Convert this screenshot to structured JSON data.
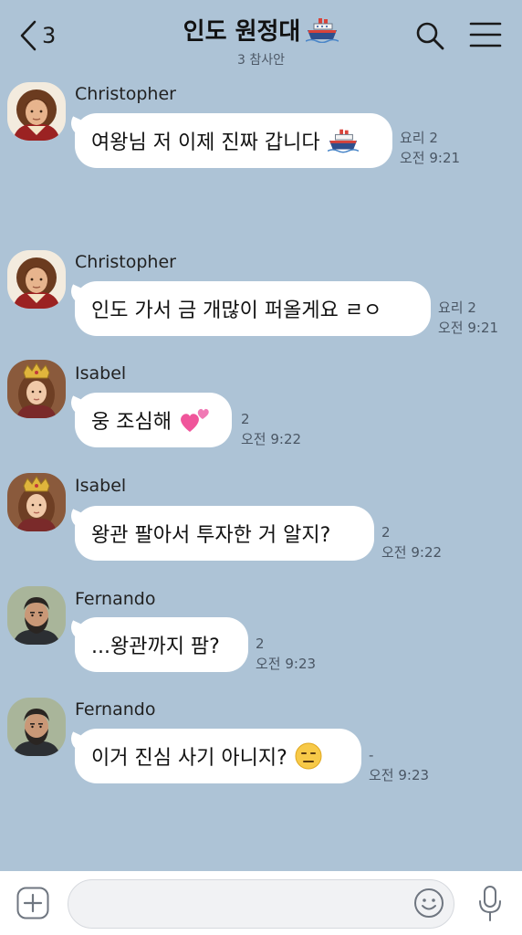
{
  "header": {
    "back_count": "3",
    "title": "인도 원정대",
    "title_icon": "ship-icon",
    "subtitle": "3 참사안",
    "search_icon": "search-icon",
    "menu_icon": "menu-icon"
  },
  "messages": [
    {
      "sender": "Christopher",
      "text": "여왕님 저 이제 진짜 갑니다",
      "emoji": "ship-emoji",
      "unread": "요리 2",
      "time": "오전 9:21"
    },
    {
      "sender": "Christopher",
      "text": "인도 가서 금 개많이 퍼올게요 ㄹㅇ",
      "emoji": "",
      "unread": "요리 2",
      "time": "오전 9:21"
    },
    {
      "sender": "Isabel",
      "text": "웅 조심해",
      "emoji": "two-hearts-emoji",
      "unread": "2",
      "time": "오전 9:22"
    },
    {
      "sender": "Isabel",
      "text": "왕관 팔아서 투자한 거 알지?",
      "emoji": "",
      "unread": "2",
      "time": "오전 9:22"
    },
    {
      "sender": "Fernando",
      "text": "...왕관까지 팜?",
      "emoji": "",
      "unread": "2",
      "time": "오전 9:23"
    },
    {
      "sender": "Fernando",
      "text": "이거 진심 사기 아니지?",
      "emoji": "expressionless-emoji",
      "unread": "-",
      "time": "오전 9:23"
    }
  ],
  "input": {
    "placeholder": "",
    "plus_icon": "plus-icon",
    "emoji_icon": "emoji-icon",
    "mic_icon": "microphone-icon"
  },
  "colors": {
    "background": "#adc3d6",
    "bubble": "#ffffff",
    "input_bar": "#ffffff"
  }
}
